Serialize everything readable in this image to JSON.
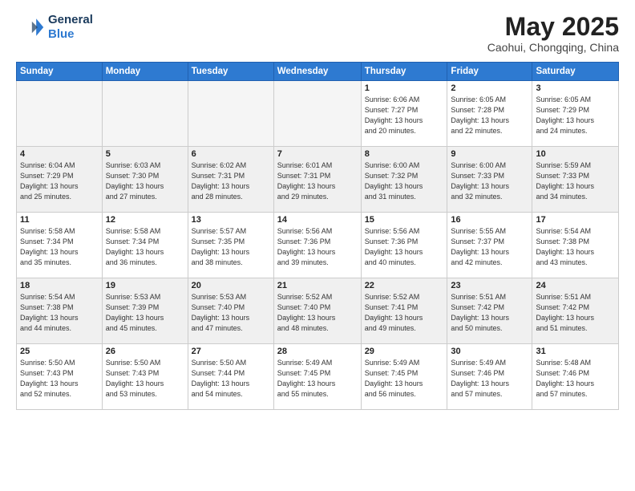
{
  "header": {
    "logo_line1": "General",
    "logo_line2": "Blue",
    "month": "May 2025",
    "location": "Caohui, Chongqing, China"
  },
  "weekdays": [
    "Sunday",
    "Monday",
    "Tuesday",
    "Wednesday",
    "Thursday",
    "Friday",
    "Saturday"
  ],
  "weeks": [
    [
      {
        "day": "",
        "info": ""
      },
      {
        "day": "",
        "info": ""
      },
      {
        "day": "",
        "info": ""
      },
      {
        "day": "",
        "info": ""
      },
      {
        "day": "1",
        "info": "Sunrise: 6:06 AM\nSunset: 7:27 PM\nDaylight: 13 hours\nand 20 minutes."
      },
      {
        "day": "2",
        "info": "Sunrise: 6:05 AM\nSunset: 7:28 PM\nDaylight: 13 hours\nand 22 minutes."
      },
      {
        "day": "3",
        "info": "Sunrise: 6:05 AM\nSunset: 7:29 PM\nDaylight: 13 hours\nand 24 minutes."
      }
    ],
    [
      {
        "day": "4",
        "info": "Sunrise: 6:04 AM\nSunset: 7:29 PM\nDaylight: 13 hours\nand 25 minutes."
      },
      {
        "day": "5",
        "info": "Sunrise: 6:03 AM\nSunset: 7:30 PM\nDaylight: 13 hours\nand 27 minutes."
      },
      {
        "day": "6",
        "info": "Sunrise: 6:02 AM\nSunset: 7:31 PM\nDaylight: 13 hours\nand 28 minutes."
      },
      {
        "day": "7",
        "info": "Sunrise: 6:01 AM\nSunset: 7:31 PM\nDaylight: 13 hours\nand 29 minutes."
      },
      {
        "day": "8",
        "info": "Sunrise: 6:00 AM\nSunset: 7:32 PM\nDaylight: 13 hours\nand 31 minutes."
      },
      {
        "day": "9",
        "info": "Sunrise: 6:00 AM\nSunset: 7:33 PM\nDaylight: 13 hours\nand 32 minutes."
      },
      {
        "day": "10",
        "info": "Sunrise: 5:59 AM\nSunset: 7:33 PM\nDaylight: 13 hours\nand 34 minutes."
      }
    ],
    [
      {
        "day": "11",
        "info": "Sunrise: 5:58 AM\nSunset: 7:34 PM\nDaylight: 13 hours\nand 35 minutes."
      },
      {
        "day": "12",
        "info": "Sunrise: 5:58 AM\nSunset: 7:34 PM\nDaylight: 13 hours\nand 36 minutes."
      },
      {
        "day": "13",
        "info": "Sunrise: 5:57 AM\nSunset: 7:35 PM\nDaylight: 13 hours\nand 38 minutes."
      },
      {
        "day": "14",
        "info": "Sunrise: 5:56 AM\nSunset: 7:36 PM\nDaylight: 13 hours\nand 39 minutes."
      },
      {
        "day": "15",
        "info": "Sunrise: 5:56 AM\nSunset: 7:36 PM\nDaylight: 13 hours\nand 40 minutes."
      },
      {
        "day": "16",
        "info": "Sunrise: 5:55 AM\nSunset: 7:37 PM\nDaylight: 13 hours\nand 42 minutes."
      },
      {
        "day": "17",
        "info": "Sunrise: 5:54 AM\nSunset: 7:38 PM\nDaylight: 13 hours\nand 43 minutes."
      }
    ],
    [
      {
        "day": "18",
        "info": "Sunrise: 5:54 AM\nSunset: 7:38 PM\nDaylight: 13 hours\nand 44 minutes."
      },
      {
        "day": "19",
        "info": "Sunrise: 5:53 AM\nSunset: 7:39 PM\nDaylight: 13 hours\nand 45 minutes."
      },
      {
        "day": "20",
        "info": "Sunrise: 5:53 AM\nSunset: 7:40 PM\nDaylight: 13 hours\nand 47 minutes."
      },
      {
        "day": "21",
        "info": "Sunrise: 5:52 AM\nSunset: 7:40 PM\nDaylight: 13 hours\nand 48 minutes."
      },
      {
        "day": "22",
        "info": "Sunrise: 5:52 AM\nSunset: 7:41 PM\nDaylight: 13 hours\nand 49 minutes."
      },
      {
        "day": "23",
        "info": "Sunrise: 5:51 AM\nSunset: 7:42 PM\nDaylight: 13 hours\nand 50 minutes."
      },
      {
        "day": "24",
        "info": "Sunrise: 5:51 AM\nSunset: 7:42 PM\nDaylight: 13 hours\nand 51 minutes."
      }
    ],
    [
      {
        "day": "25",
        "info": "Sunrise: 5:50 AM\nSunset: 7:43 PM\nDaylight: 13 hours\nand 52 minutes."
      },
      {
        "day": "26",
        "info": "Sunrise: 5:50 AM\nSunset: 7:43 PM\nDaylight: 13 hours\nand 53 minutes."
      },
      {
        "day": "27",
        "info": "Sunrise: 5:50 AM\nSunset: 7:44 PM\nDaylight: 13 hours\nand 54 minutes."
      },
      {
        "day": "28",
        "info": "Sunrise: 5:49 AM\nSunset: 7:45 PM\nDaylight: 13 hours\nand 55 minutes."
      },
      {
        "day": "29",
        "info": "Sunrise: 5:49 AM\nSunset: 7:45 PM\nDaylight: 13 hours\nand 56 minutes."
      },
      {
        "day": "30",
        "info": "Sunrise: 5:49 AM\nSunset: 7:46 PM\nDaylight: 13 hours\nand 57 minutes."
      },
      {
        "day": "31",
        "info": "Sunrise: 5:48 AM\nSunset: 7:46 PM\nDaylight: 13 hours\nand 57 minutes."
      }
    ]
  ]
}
